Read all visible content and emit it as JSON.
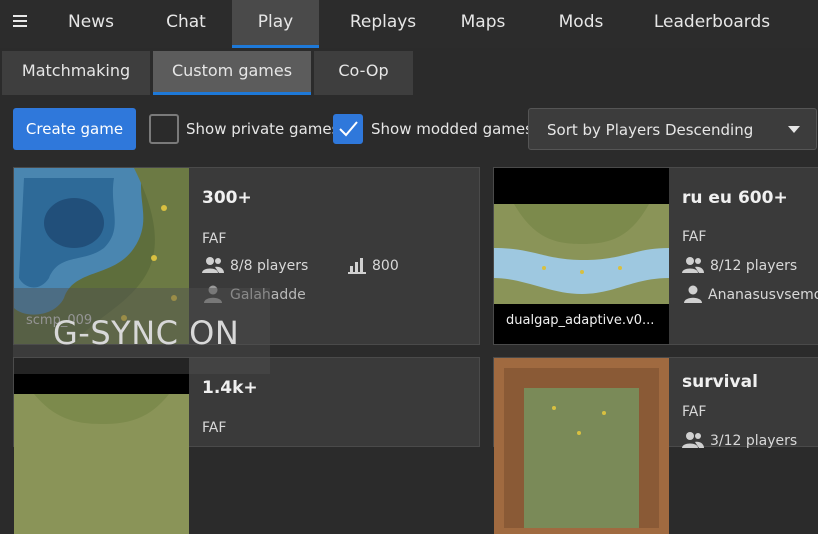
{
  "nav": {
    "items": [
      {
        "label": "News"
      },
      {
        "label": "Chat"
      },
      {
        "label": "Play"
      },
      {
        "label": "Replays"
      },
      {
        "label": "Maps"
      },
      {
        "label": "Mods"
      },
      {
        "label": "Leaderboards"
      }
    ]
  },
  "subnav": {
    "items": [
      {
        "label": "Matchmaking"
      },
      {
        "label": "Custom games"
      },
      {
        "label": "Co-Op"
      }
    ]
  },
  "toolbar": {
    "create_label": "Create game",
    "private_label": "Show private games",
    "private_checked": false,
    "modded_label": "Show modded games",
    "modded_checked": true,
    "sort_label": "Sort by Players Descending"
  },
  "games": [
    {
      "title": "300+",
      "featured": "FAF",
      "players": "8/8 players",
      "rating": "800",
      "host": "Galahadde",
      "map": "scmp_009"
    },
    {
      "title": "ru eu 600+",
      "featured": "FAF",
      "players": "8/12 players",
      "host": "Ananasusvsemog",
      "map": "dualgap_adaptive.v0..."
    },
    {
      "title": "1.4k+",
      "featured": "FAF"
    },
    {
      "title": "survival",
      "featured": "FAF",
      "players": "3/12 players"
    }
  ],
  "overlay": {
    "text": "G-SYNC ON"
  },
  "colors": {
    "accent": "#1e79d8",
    "button": "#2f78db"
  }
}
